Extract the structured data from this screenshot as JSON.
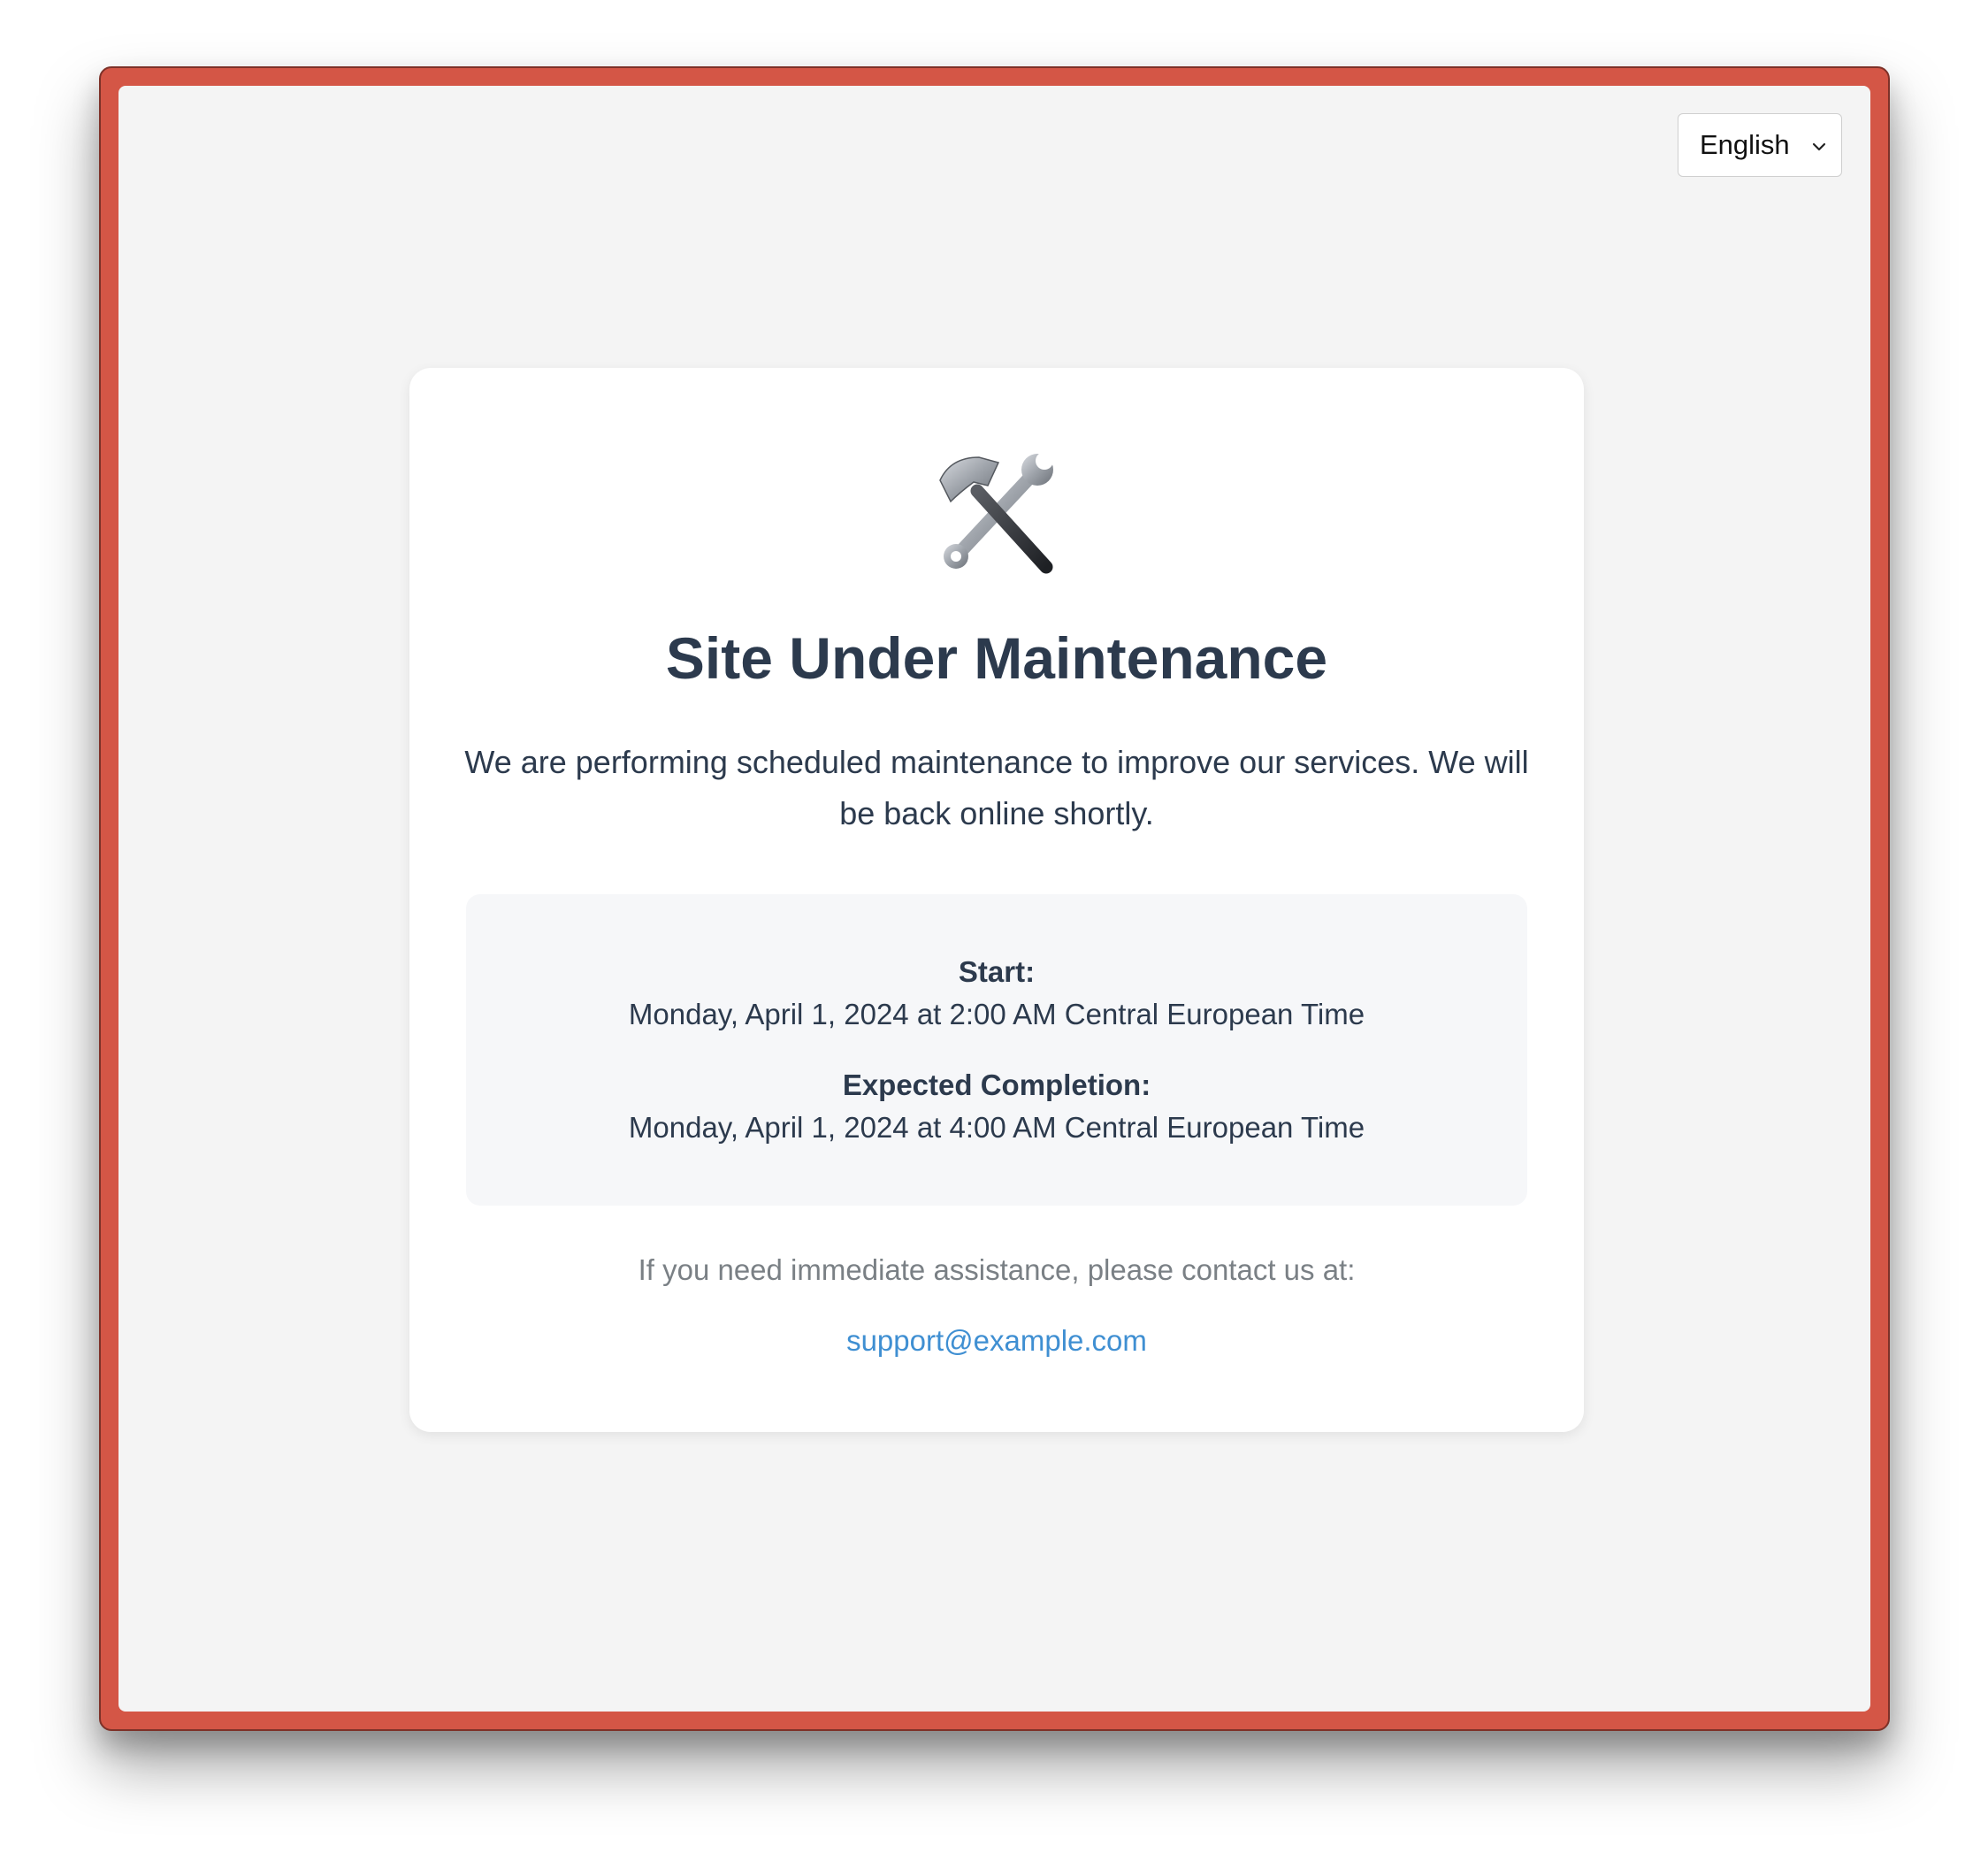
{
  "language_select": {
    "selected": "English",
    "icon": "chevron-down-icon"
  },
  "maintenance": {
    "icon": "hammer-and-wrench-icon",
    "title": "Site Under Maintenance",
    "message": "We are performing scheduled maintenance to improve our services. We will be back online shortly.",
    "schedule": {
      "start_label": "Start:",
      "start_value": "Monday, April 1, 2024 at 2:00 AM Central European Time",
      "completion_label": "Expected Completion:",
      "completion_value": "Monday, April 1, 2024 at 4:00 AM Central European Time"
    },
    "contact": {
      "text": "If you need immediate assistance, please contact us at:",
      "email": "support@example.com"
    }
  },
  "colors": {
    "frame": "#d45646",
    "page_background": "#f4f4f4",
    "heading_text": "#2c3a4d",
    "muted_text": "#7a8085",
    "link": "#3f8fd2"
  }
}
